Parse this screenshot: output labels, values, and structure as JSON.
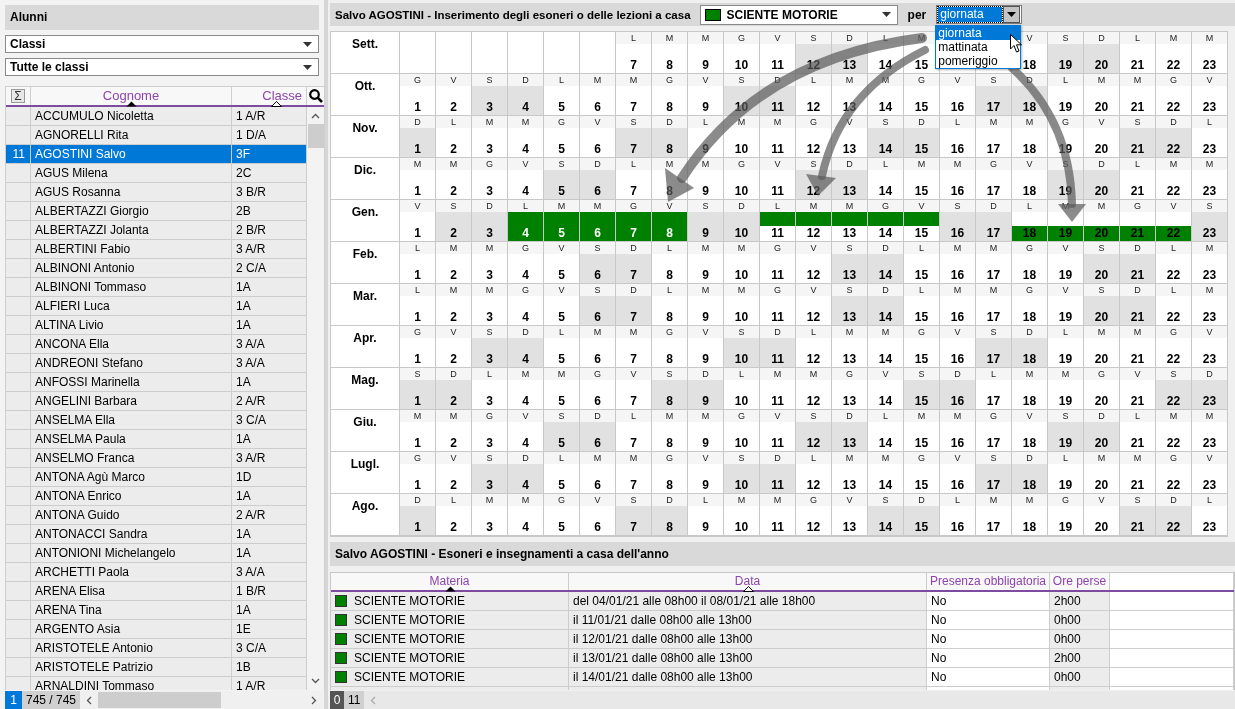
{
  "students_panel": {
    "title": "Alunni",
    "filters": [
      {
        "value": "Classi"
      },
      {
        "value": "Tutte le classi"
      }
    ],
    "columns": [
      {
        "label": "Σ",
        "kind": "icon"
      },
      {
        "label": "Cognome",
        "sorted": true,
        "primary": true
      },
      {
        "label": "Classe",
        "sorted": true,
        "primary": false
      }
    ],
    "rows": [
      {
        "name": "ACCUMULO Nicoletta",
        "class": "1 A/R",
        "selected": false
      },
      {
        "name": "AGNORELLI Rita",
        "class": "1 D/A",
        "selected": false
      },
      {
        "number": "11",
        "name": "AGOSTINI Salvo",
        "class": "3F",
        "selected": true
      },
      {
        "name": "AGUS Milena",
        "class": "2C",
        "selected": false
      },
      {
        "name": "AGUS Rosanna",
        "class": "3 B/R",
        "selected": false
      },
      {
        "name": "ALBERTAZZI Giorgio",
        "class": "2B",
        "selected": false
      },
      {
        "name": "ALBERTAZZI Jolanta",
        "class": "2 B/R",
        "selected": false
      },
      {
        "name": "ALBERTINI Fabio",
        "class": "3 A/R",
        "selected": false
      },
      {
        "name": "ALBINONI Antonio",
        "class": "2 C/A",
        "selected": false
      },
      {
        "name": "ALBINONI Tommaso",
        "class": "1A",
        "selected": false
      },
      {
        "name": "ALFIERI Luca",
        "class": "1A",
        "selected": false
      },
      {
        "name": "ALTINA Livio",
        "class": "1A",
        "selected": false
      },
      {
        "name": "ANCONA Ella",
        "class": "3 A/A",
        "selected": false
      },
      {
        "name": "ANDREONI Stefano",
        "class": "3 A/A",
        "selected": false
      },
      {
        "name": "ANFOSSI Marinella",
        "class": "1A",
        "selected": false
      },
      {
        "name": "ANGELINI Barbara",
        "class": "2 A/R",
        "selected": false
      },
      {
        "name": "ANSELMA Ella",
        "class": "3 C/A",
        "selected": false
      },
      {
        "name": "ANSELMA Paula",
        "class": "1A",
        "selected": false
      },
      {
        "name": "ANSELMO Franca",
        "class": "3 A/R",
        "selected": false
      },
      {
        "name": "ANTONA Agù Marco",
        "class": "1D",
        "selected": false
      },
      {
        "name": "ANTONA Enrico",
        "class": "1A",
        "selected": false
      },
      {
        "name": "ANTONA Guido",
        "class": "2 A/R",
        "selected": false
      },
      {
        "name": "ANTONACCI Sandra",
        "class": "1A",
        "selected": false
      },
      {
        "name": "ANTONIONI Michelangelo",
        "class": "1A",
        "selected": false
      },
      {
        "name": "ARCHETTI Paola",
        "class": "3 A/A",
        "selected": false
      },
      {
        "name": "ARENA Elisa",
        "class": "1 B/R",
        "selected": false
      },
      {
        "name": "ARENA Tina",
        "class": "1A",
        "selected": false
      },
      {
        "name": "ARGENTO Asia",
        "class": "1E",
        "selected": false
      },
      {
        "name": "ARISTOTELE Antonio",
        "class": "3 C/A",
        "selected": false
      },
      {
        "name": "ARISTOTELE Patrizio",
        "class": "1B",
        "selected": false
      },
      {
        "name": "ARNALDINI Tommaso",
        "class": "1 A/R",
        "selected": false
      }
    ],
    "footer": {
      "page": "1",
      "count": "745 / 745"
    }
  },
  "editor": {
    "title": "Salvo AGOSTINI - Inserimento degli esoneri o delle lezioni a casa",
    "subject": {
      "value": "SCIENTE MOTORIE",
      "color": "#008000"
    },
    "per_label": "per",
    "period": {
      "value": "giornata",
      "expanded": true,
      "options": [
        {
          "label": "giornata",
          "selected": true
        },
        {
          "label": "mattinata",
          "selected": false
        },
        {
          "label": "pomeriggio",
          "selected": false
        }
      ]
    }
  },
  "calendar": {
    "months": [
      {
        "name": "Sett.",
        "days": [
          {
            "kind": "blank"
          },
          {
            "kind": "blank"
          },
          {
            "kind": "blank"
          },
          {
            "kind": "blank"
          },
          {
            "kind": "blank"
          },
          {
            "kind": "blank"
          },
          {
            "kind": "day",
            "weekday": "L",
            "day": "7",
            "shaded": false
          },
          {
            "kind": "day",
            "weekday": "M",
            "day": "8",
            "shaded": false
          },
          {
            "kind": "day",
            "weekday": "M",
            "day": "9",
            "shaded": false
          },
          {
            "kind": "day",
            "weekday": "G",
            "day": "10",
            "shaded": false
          },
          {
            "kind": "day",
            "weekday": "V",
            "day": "11",
            "shaded": false
          },
          {
            "kind": "day",
            "weekday": "S",
            "day": "12",
            "shaded": true
          },
          {
            "kind": "day",
            "weekday": "D",
            "day": "13",
            "shaded": true
          },
          {
            "kind": "day",
            "weekday": "L",
            "day": "14",
            "shaded": false
          },
          {
            "kind": "day",
            "weekday": "M",
            "day": "15",
            "shaded": false
          },
          {
            "kind": "covered"
          },
          {
            "kind": "covered"
          },
          {
            "kind": "day",
            "weekday": "V",
            "day": "18",
            "shaded": false
          },
          {
            "kind": "day",
            "weekday": "S",
            "day": "19",
            "shaded": true
          },
          {
            "kind": "day",
            "weekday": "D",
            "day": "20",
            "shaded": true
          },
          {
            "kind": "day",
            "weekday": "L",
            "day": "21",
            "shaded": false
          },
          {
            "kind": "day",
            "weekday": "M",
            "day": "22",
            "shaded": false
          },
          {
            "kind": "day",
            "weekday": "M",
            "day": "23",
            "shaded": false
          }
        ]
      },
      {
        "name": "Ott.",
        "days": [
          {
            "weekday": "G",
            "day": "1",
            "shaded": false
          },
          {
            "weekday": "V",
            "day": "2",
            "shaded": false
          },
          {
            "weekday": "S",
            "day": "3",
            "shaded": true
          },
          {
            "weekday": "D",
            "day": "4",
            "shaded": true
          },
          {
            "weekday": "L",
            "day": "5",
            "shaded": false
          },
          {
            "weekday": "M",
            "day": "6",
            "shaded": false
          },
          {
            "weekday": "M",
            "day": "7",
            "shaded": false
          },
          {
            "weekday": "G",
            "day": "8",
            "shaded": false
          },
          {
            "weekday": "V",
            "day": "9",
            "shaded": false
          },
          {
            "weekday": "S",
            "day": "10",
            "shaded": true
          },
          {
            "weekday": "D",
            "day": "11",
            "shaded": true
          },
          {
            "weekday": "L",
            "day": "12",
            "shaded": false
          },
          {
            "weekday": "M",
            "day": "13",
            "shaded": false
          },
          {
            "weekday": "M",
            "day": "14",
            "shaded": false
          },
          {
            "weekday": "G",
            "day": "15",
            "shaded": false
          },
          {
            "weekday": "V",
            "day": "16",
            "shaded": false
          },
          {
            "weekday": "S",
            "day": "17",
            "shaded": true
          },
          {
            "weekday": "D",
            "day": "18",
            "shaded": true
          },
          {
            "weekday": "L",
            "day": "19",
            "shaded": false
          },
          {
            "weekday": "M",
            "day": "20",
            "shaded": false
          },
          {
            "weekday": "M",
            "day": "21",
            "shaded": false
          },
          {
            "weekday": "G",
            "day": "22",
            "shaded": false
          },
          {
            "weekday": "V",
            "day": "23",
            "shaded": false
          }
        ]
      },
      {
        "name": "Nov.",
        "days": [
          {
            "weekday": "D",
            "day": "1",
            "shaded": true
          },
          {
            "weekday": "L",
            "day": "2",
            "shaded": false
          },
          {
            "weekday": "M",
            "day": "3",
            "shaded": false
          },
          {
            "weekday": "M",
            "day": "4",
            "shaded": false
          },
          {
            "weekday": "G",
            "day": "5",
            "shaded": false
          },
          {
            "weekday": "V",
            "day": "6",
            "shaded": false
          },
          {
            "weekday": "S",
            "day": "7",
            "shaded": true
          },
          {
            "weekday": "D",
            "day": "8",
            "shaded": true
          },
          {
            "weekday": "L",
            "day": "9",
            "shaded": false
          },
          {
            "weekday": "M",
            "day": "10",
            "shaded": false
          },
          {
            "weekday": "M",
            "day": "11",
            "shaded": false
          },
          {
            "weekday": "G",
            "day": "12",
            "shaded": false
          },
          {
            "weekday": "V",
            "day": "13",
            "shaded": false
          },
          {
            "weekday": "S",
            "day": "14",
            "shaded": true
          },
          {
            "weekday": "D",
            "day": "15",
            "shaded": true
          },
          {
            "weekday": "L",
            "day": "16",
            "shaded": false
          },
          {
            "weekday": "M",
            "day": "17",
            "shaded": false
          },
          {
            "weekday": "M",
            "day": "18",
            "shaded": false
          },
          {
            "weekday": "G",
            "day": "19",
            "shaded": false
          },
          {
            "weekday": "V",
            "day": "20",
            "shaded": false
          },
          {
            "weekday": "S",
            "day": "21",
            "shaded": true
          },
          {
            "weekday": "D",
            "day": "22",
            "shaded": true
          },
          {
            "weekday": "L",
            "day": "23",
            "shaded": false
          }
        ]
      },
      {
        "name": "Dic.",
        "days": [
          {
            "weekday": "M",
            "day": "1",
            "shaded": false
          },
          {
            "weekday": "M",
            "day": "2",
            "shaded": false
          },
          {
            "weekday": "G",
            "day": "3",
            "shaded": false
          },
          {
            "weekday": "V",
            "day": "4",
            "shaded": false
          },
          {
            "weekday": "S",
            "day": "5",
            "shaded": true
          },
          {
            "weekday": "D",
            "day": "6",
            "shaded": true
          },
          {
            "weekday": "L",
            "day": "7",
            "shaded": false
          },
          {
            "weekday": "M",
            "day": "8",
            "shaded": false
          },
          {
            "weekday": "M",
            "day": "9",
            "shaded": false
          },
          {
            "weekday": "G",
            "day": "10",
            "shaded": false
          },
          {
            "weekday": "V",
            "day": "11",
            "shaded": false
          },
          {
            "weekday": "S",
            "day": "12",
            "shaded": true
          },
          {
            "weekday": "D",
            "day": "13",
            "shaded": true
          },
          {
            "weekday": "L",
            "day": "14",
            "shaded": false
          },
          {
            "weekday": "M",
            "day": "15",
            "shaded": false
          },
          {
            "weekday": "M",
            "day": "16",
            "shaded": false
          },
          {
            "weekday": "G",
            "day": "17",
            "shaded": false
          },
          {
            "weekday": "V",
            "day": "18",
            "shaded": false
          },
          {
            "weekday": "S",
            "day": "19",
            "shaded": true
          },
          {
            "weekday": "D",
            "day": "20",
            "shaded": true
          },
          {
            "weekday": "L",
            "day": "21",
            "shaded": false
          },
          {
            "weekday": "M",
            "day": "22",
            "shaded": false
          },
          {
            "weekday": "M",
            "day": "23",
            "shaded": false
          }
        ]
      },
      {
        "name": "Gen.",
        "days": [
          {
            "weekday": "V",
            "day": "1",
            "shaded": false,
            "morning_exempt": false,
            "afternoon_exempt": false
          },
          {
            "weekday": "S",
            "day": "2",
            "shaded": true,
            "morning_exempt": false,
            "afternoon_exempt": false
          },
          {
            "weekday": "D",
            "day": "3",
            "shaded": true,
            "morning_exempt": false,
            "afternoon_exempt": false
          },
          {
            "weekday": "L",
            "day": "4",
            "shaded": false,
            "morning_exempt": true,
            "afternoon_exempt": true
          },
          {
            "weekday": "M",
            "day": "5",
            "shaded": false,
            "morning_exempt": true,
            "afternoon_exempt": true
          },
          {
            "weekday": "M",
            "day": "6",
            "shaded": false,
            "morning_exempt": true,
            "afternoon_exempt": true
          },
          {
            "weekday": "G",
            "day": "7",
            "shaded": false,
            "morning_exempt": true,
            "afternoon_exempt": true
          },
          {
            "weekday": "V",
            "day": "8",
            "shaded": false,
            "morning_exempt": true,
            "afternoon_exempt": true
          },
          {
            "weekday": "S",
            "day": "9",
            "shaded": true,
            "morning_exempt": false,
            "afternoon_exempt": false
          },
          {
            "weekday": "D",
            "day": "10",
            "shaded": true,
            "morning_exempt": false,
            "afternoon_exempt": false
          },
          {
            "weekday": "L",
            "day": "11",
            "shaded": false,
            "morning_exempt": true,
            "afternoon_exempt": false
          },
          {
            "weekday": "M",
            "day": "12",
            "shaded": false,
            "morning_exempt": true,
            "afternoon_exempt": false
          },
          {
            "weekday": "M",
            "day": "13",
            "shaded": false,
            "morning_exempt": true,
            "afternoon_exempt": false
          },
          {
            "weekday": "G",
            "day": "14",
            "shaded": false,
            "morning_exempt": true,
            "afternoon_exempt": false
          },
          {
            "weekday": "V",
            "day": "15",
            "shaded": false,
            "morning_exempt": true,
            "afternoon_exempt": false
          },
          {
            "weekday": "S",
            "day": "16",
            "shaded": true,
            "morning_exempt": false,
            "afternoon_exempt": false
          },
          {
            "weekday": "D",
            "day": "17",
            "shaded": true,
            "morning_exempt": false,
            "afternoon_exempt": false
          },
          {
            "weekday": "L",
            "day": "18",
            "shaded": false,
            "morning_exempt": false,
            "afternoon_exempt": true
          },
          {
            "weekday": "M",
            "day": "19",
            "shaded": false,
            "morning_exempt": false,
            "afternoon_exempt": true
          },
          {
            "weekday": "M",
            "day": "20",
            "shaded": false,
            "morning_exempt": false,
            "afternoon_exempt": true
          },
          {
            "weekday": "G",
            "day": "21",
            "shaded": false,
            "morning_exempt": false,
            "afternoon_exempt": true
          },
          {
            "weekday": "V",
            "day": "22",
            "shaded": false,
            "morning_exempt": false,
            "afternoon_exempt": true
          },
          {
            "weekday": "S",
            "day": "23",
            "shaded": true,
            "morning_exempt": false,
            "afternoon_exempt": false
          }
        ]
      },
      {
        "name": "Feb.",
        "days": [
          {
            "weekday": "L",
            "day": "1",
            "shaded": false
          },
          {
            "weekday": "M",
            "day": "2",
            "shaded": false
          },
          {
            "weekday": "M",
            "day": "3",
            "shaded": false
          },
          {
            "weekday": "G",
            "day": "4",
            "shaded": false
          },
          {
            "weekday": "V",
            "day": "5",
            "shaded": false
          },
          {
            "weekday": "S",
            "day": "6",
            "shaded": true
          },
          {
            "weekday": "D",
            "day": "7",
            "shaded": true
          },
          {
            "weekday": "L",
            "day": "8",
            "shaded": false
          },
          {
            "weekday": "M",
            "day": "9",
            "shaded": false
          },
          {
            "weekday": "M",
            "day": "10",
            "shaded": false
          },
          {
            "weekday": "G",
            "day": "11",
            "shaded": false
          },
          {
            "weekday": "V",
            "day": "12",
            "shaded": false
          },
          {
            "weekday": "S",
            "day": "13",
            "shaded": true
          },
          {
            "weekday": "D",
            "day": "14",
            "shaded": true
          },
          {
            "weekday": "L",
            "day": "15",
            "shaded": false
          },
          {
            "weekday": "M",
            "day": "16",
            "shaded": false
          },
          {
            "weekday": "M",
            "day": "17",
            "shaded": false
          },
          {
            "weekday": "G",
            "day": "18",
            "shaded": false
          },
          {
            "weekday": "V",
            "day": "19",
            "shaded": false
          },
          {
            "weekday": "S",
            "day": "20",
            "shaded": true
          },
          {
            "weekday": "D",
            "day": "21",
            "shaded": true
          },
          {
            "weekday": "L",
            "day": "22",
            "shaded": false
          },
          {
            "weekday": "M",
            "day": "23",
            "shaded": false
          }
        ]
      },
      {
        "name": "Mar.",
        "days": [
          {
            "weekday": "L",
            "day": "1",
            "shaded": false
          },
          {
            "weekday": "M",
            "day": "2",
            "shaded": false
          },
          {
            "weekday": "M",
            "day": "3",
            "shaded": false
          },
          {
            "weekday": "G",
            "day": "4",
            "shaded": false
          },
          {
            "weekday": "V",
            "day": "5",
            "shaded": false
          },
          {
            "weekday": "S",
            "day": "6",
            "shaded": true
          },
          {
            "weekday": "D",
            "day": "7",
            "shaded": true
          },
          {
            "weekday": "L",
            "day": "8",
            "shaded": false
          },
          {
            "weekday": "M",
            "day": "9",
            "shaded": false
          },
          {
            "weekday": "M",
            "day": "10",
            "shaded": false
          },
          {
            "weekday": "G",
            "day": "11",
            "shaded": false
          },
          {
            "weekday": "V",
            "day": "12",
            "shaded": false
          },
          {
            "weekday": "S",
            "day": "13",
            "shaded": true
          },
          {
            "weekday": "D",
            "day": "14",
            "shaded": true
          },
          {
            "weekday": "L",
            "day": "15",
            "shaded": false
          },
          {
            "weekday": "M",
            "day": "16",
            "shaded": false
          },
          {
            "weekday": "M",
            "day": "17",
            "shaded": false
          },
          {
            "weekday": "G",
            "day": "18",
            "shaded": false
          },
          {
            "weekday": "V",
            "day": "19",
            "shaded": false
          },
          {
            "weekday": "S",
            "day": "20",
            "shaded": true
          },
          {
            "weekday": "D",
            "day": "21",
            "shaded": true
          },
          {
            "weekday": "L",
            "day": "22",
            "shaded": false
          },
          {
            "weekday": "M",
            "day": "23",
            "shaded": false
          }
        ]
      },
      {
        "name": "Apr.",
        "days": [
          {
            "weekday": "G",
            "day": "1",
            "shaded": false
          },
          {
            "weekday": "V",
            "day": "2",
            "shaded": false
          },
          {
            "weekday": "S",
            "day": "3",
            "shaded": true
          },
          {
            "weekday": "D",
            "day": "4",
            "shaded": true
          },
          {
            "weekday": "L",
            "day": "5",
            "shaded": false
          },
          {
            "weekday": "M",
            "day": "6",
            "shaded": false
          },
          {
            "weekday": "M",
            "day": "7",
            "shaded": false
          },
          {
            "weekday": "G",
            "day": "8",
            "shaded": false
          },
          {
            "weekday": "V",
            "day": "9",
            "shaded": false
          },
          {
            "weekday": "S",
            "day": "10",
            "shaded": true
          },
          {
            "weekday": "D",
            "day": "11",
            "shaded": true
          },
          {
            "weekday": "L",
            "day": "12",
            "shaded": false
          },
          {
            "weekday": "M",
            "day": "13",
            "shaded": false
          },
          {
            "weekday": "M",
            "day": "14",
            "shaded": false
          },
          {
            "weekday": "G",
            "day": "15",
            "shaded": false
          },
          {
            "weekday": "V",
            "day": "16",
            "shaded": false
          },
          {
            "weekday": "S",
            "day": "17",
            "shaded": true
          },
          {
            "weekday": "D",
            "day": "18",
            "shaded": true
          },
          {
            "weekday": "L",
            "day": "19",
            "shaded": false
          },
          {
            "weekday": "M",
            "day": "20",
            "shaded": false
          },
          {
            "weekday": "M",
            "day": "21",
            "shaded": false
          },
          {
            "weekday": "G",
            "day": "22",
            "shaded": false
          },
          {
            "weekday": "V",
            "day": "23",
            "shaded": false
          }
        ]
      },
      {
        "name": "Mag.",
        "days": [
          {
            "weekday": "S",
            "day": "1",
            "shaded": true
          },
          {
            "weekday": "D",
            "day": "2",
            "shaded": true
          },
          {
            "weekday": "L",
            "day": "3",
            "shaded": false
          },
          {
            "weekday": "M",
            "day": "4",
            "shaded": false
          },
          {
            "weekday": "M",
            "day": "5",
            "shaded": false
          },
          {
            "weekday": "G",
            "day": "6",
            "shaded": false
          },
          {
            "weekday": "V",
            "day": "7",
            "shaded": false
          },
          {
            "weekday": "S",
            "day": "8",
            "shaded": true
          },
          {
            "weekday": "D",
            "day": "9",
            "shaded": true
          },
          {
            "weekday": "L",
            "day": "10",
            "shaded": false
          },
          {
            "weekday": "M",
            "day": "11",
            "shaded": false
          },
          {
            "weekday": "M",
            "day": "12",
            "shaded": false
          },
          {
            "weekday": "G",
            "day": "13",
            "shaded": false
          },
          {
            "weekday": "V",
            "day": "14",
            "shaded": false
          },
          {
            "weekday": "S",
            "day": "15",
            "shaded": true
          },
          {
            "weekday": "D",
            "day": "16",
            "shaded": true
          },
          {
            "weekday": "L",
            "day": "17",
            "shaded": false
          },
          {
            "weekday": "M",
            "day": "18",
            "shaded": false
          },
          {
            "weekday": "M",
            "day": "19",
            "shaded": false
          },
          {
            "weekday": "G",
            "day": "20",
            "shaded": false
          },
          {
            "weekday": "V",
            "day": "21",
            "shaded": false
          },
          {
            "weekday": "S",
            "day": "22",
            "shaded": true
          },
          {
            "weekday": "D",
            "day": "23",
            "shaded": true
          }
        ]
      },
      {
        "name": "Giu.",
        "days": [
          {
            "weekday": "M",
            "day": "1",
            "shaded": false
          },
          {
            "weekday": "M",
            "day": "2",
            "shaded": false
          },
          {
            "weekday": "G",
            "day": "3",
            "shaded": false
          },
          {
            "weekday": "V",
            "day": "4",
            "shaded": false
          },
          {
            "weekday": "S",
            "day": "5",
            "shaded": true
          },
          {
            "weekday": "D",
            "day": "6",
            "shaded": true
          },
          {
            "weekday": "L",
            "day": "7",
            "shaded": false
          },
          {
            "weekday": "M",
            "day": "8",
            "shaded": false
          },
          {
            "weekday": "M",
            "day": "9",
            "shaded": false
          },
          {
            "weekday": "G",
            "day": "10",
            "shaded": false
          },
          {
            "weekday": "V",
            "day": "11",
            "shaded": false
          },
          {
            "weekday": "S",
            "day": "12",
            "shaded": true
          },
          {
            "weekday": "D",
            "day": "13",
            "shaded": true
          },
          {
            "weekday": "L",
            "day": "14",
            "shaded": false
          },
          {
            "weekday": "M",
            "day": "15",
            "shaded": false
          },
          {
            "weekday": "M",
            "day": "16",
            "shaded": false
          },
          {
            "weekday": "G",
            "day": "17",
            "shaded": false
          },
          {
            "weekday": "V",
            "day": "18",
            "shaded": false
          },
          {
            "weekday": "S",
            "day": "19",
            "shaded": true
          },
          {
            "weekday": "D",
            "day": "20",
            "shaded": true
          },
          {
            "weekday": "L",
            "day": "21",
            "shaded": false
          },
          {
            "weekday": "M",
            "day": "22",
            "shaded": false
          },
          {
            "weekday": "M",
            "day": "23",
            "shaded": false
          }
        ]
      },
      {
        "name": "Lugl.",
        "days": [
          {
            "weekday": "G",
            "day": "1",
            "shaded": false
          },
          {
            "weekday": "V",
            "day": "2",
            "shaded": false
          },
          {
            "weekday": "S",
            "day": "3",
            "shaded": true
          },
          {
            "weekday": "D",
            "day": "4",
            "shaded": true
          },
          {
            "weekday": "L",
            "day": "5",
            "shaded": false
          },
          {
            "weekday": "M",
            "day": "6",
            "shaded": false
          },
          {
            "weekday": "M",
            "day": "7",
            "shaded": false
          },
          {
            "weekday": "G",
            "day": "8",
            "shaded": false
          },
          {
            "weekday": "V",
            "day": "9",
            "shaded": false
          },
          {
            "weekday": "S",
            "day": "10",
            "shaded": true
          },
          {
            "weekday": "D",
            "day": "11",
            "shaded": true
          },
          {
            "weekday": "L",
            "day": "12",
            "shaded": false
          },
          {
            "weekday": "M",
            "day": "13",
            "shaded": false
          },
          {
            "weekday": "M",
            "day": "14",
            "shaded": false
          },
          {
            "weekday": "G",
            "day": "15",
            "shaded": false
          },
          {
            "weekday": "V",
            "day": "16",
            "shaded": false
          },
          {
            "weekday": "S",
            "day": "17",
            "shaded": true
          },
          {
            "weekday": "D",
            "day": "18",
            "shaded": true
          },
          {
            "weekday": "L",
            "day": "19",
            "shaded": false
          },
          {
            "weekday": "M",
            "day": "20",
            "shaded": false
          },
          {
            "weekday": "M",
            "day": "21",
            "shaded": false
          },
          {
            "weekday": "G",
            "day": "22",
            "shaded": false
          },
          {
            "weekday": "V",
            "day": "23",
            "shaded": false
          }
        ]
      },
      {
        "name": "Ago.",
        "days": [
          {
            "weekday": "D",
            "day": "1",
            "shaded": true
          },
          {
            "weekday": "L",
            "day": "2",
            "shaded": false
          },
          {
            "weekday": "M",
            "day": "3",
            "shaded": false
          },
          {
            "weekday": "M",
            "day": "4",
            "shaded": false
          },
          {
            "weekday": "G",
            "day": "5",
            "shaded": false
          },
          {
            "weekday": "V",
            "day": "6",
            "shaded": false
          },
          {
            "weekday": "S",
            "day": "7",
            "shaded": true
          },
          {
            "weekday": "D",
            "day": "8",
            "shaded": true
          },
          {
            "weekday": "L",
            "day": "9",
            "shaded": false
          },
          {
            "weekday": "M",
            "day": "10",
            "shaded": false
          },
          {
            "weekday": "M",
            "day": "11",
            "shaded": false
          },
          {
            "weekday": "G",
            "day": "12",
            "shaded": false
          },
          {
            "weekday": "V",
            "day": "13",
            "shaded": false
          },
          {
            "weekday": "S",
            "day": "14",
            "shaded": true
          },
          {
            "weekday": "D",
            "day": "15",
            "shaded": true
          },
          {
            "weekday": "L",
            "day": "16",
            "shaded": false
          },
          {
            "weekday": "M",
            "day": "17",
            "shaded": false
          },
          {
            "weekday": "M",
            "day": "18",
            "shaded": false
          },
          {
            "weekday": "G",
            "day": "19",
            "shaded": false
          },
          {
            "weekday": "V",
            "day": "20",
            "shaded": false
          },
          {
            "weekday": "S",
            "day": "21",
            "shaded": true
          },
          {
            "weekday": "D",
            "day": "22",
            "shaded": true
          },
          {
            "weekday": "L",
            "day": "23",
            "shaded": false
          }
        ]
      }
    ]
  },
  "exemptions": {
    "title": "Salvo AGOSTINI - Esoneri e insegnamenti a casa dell'anno",
    "columns": [
      {
        "label": "Materia",
        "sorted": true,
        "primary": true
      },
      {
        "label": "Data",
        "sorted": true,
        "primary": false
      },
      {
        "label": "Presenza obbligatoria",
        "sorted": false
      },
      {
        "label": "Ore perse",
        "sorted": false
      }
    ],
    "rows": [
      {
        "subject": "SCIENTE MOTORIE",
        "color": "#008000",
        "date": "del 04/01/21 alle 08h00 il 08/01/21 alle 18h00",
        "attendance": "No",
        "hours_lost": "2h00"
      },
      {
        "subject": "SCIENTE MOTORIE",
        "color": "#008000",
        "date": "il 11/01/21 dalle 08h00 alle 13h00",
        "attendance": "No",
        "hours_lost": "0h00"
      },
      {
        "subject": "SCIENTE MOTORIE",
        "color": "#008000",
        "date": "il 12/01/21 dalle 08h00 alle 13h00",
        "attendance": "No",
        "hours_lost": "0h00"
      },
      {
        "subject": "SCIENTE MOTORIE",
        "color": "#008000",
        "date": "il 13/01/21 dalle 08h00 alle 13h00",
        "attendance": "No",
        "hours_lost": "2h00"
      },
      {
        "subject": "SCIENTE MOTORIE",
        "color": "#008000",
        "date": "il 14/01/21 dalle 08h00 alle 13h00",
        "attendance": "No",
        "hours_lost": "0h00"
      }
    ],
    "footer": {
      "page": "0",
      "count": "11"
    }
  }
}
